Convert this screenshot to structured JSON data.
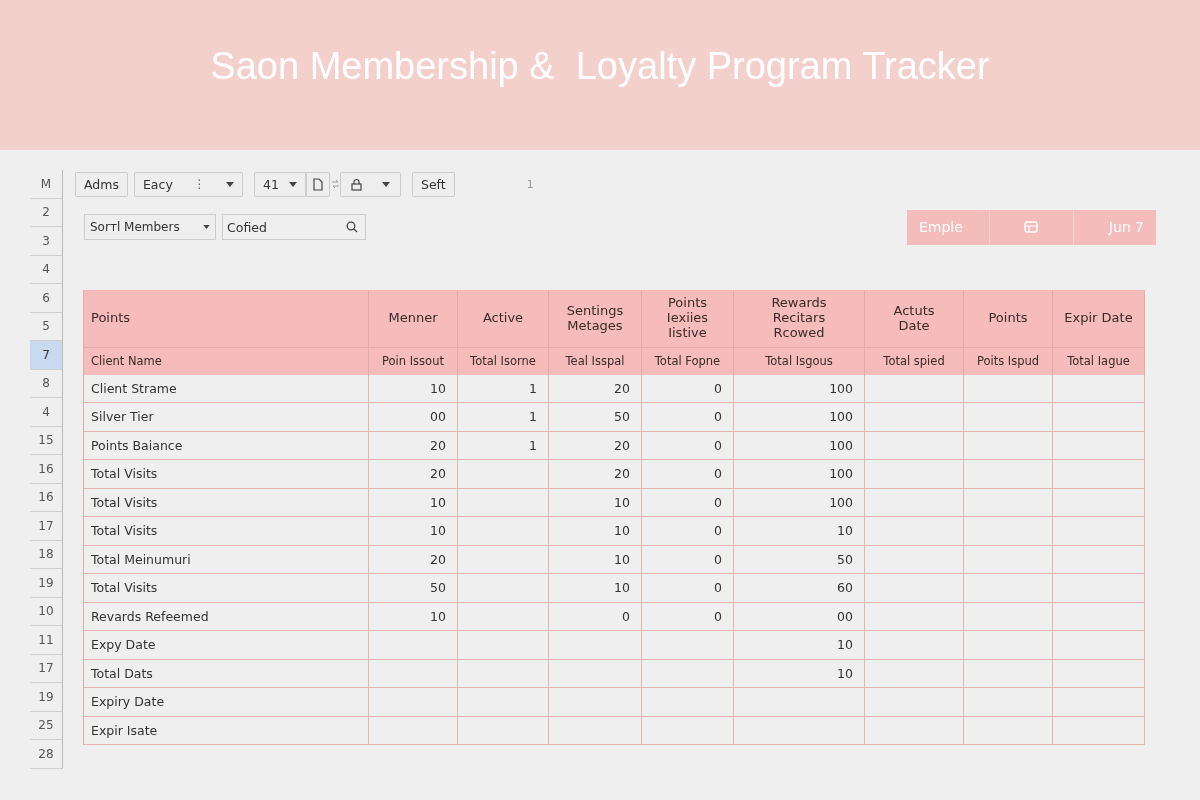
{
  "title": "Saon Membership &  Loyalty Program Tracker",
  "row_headers": [
    {
      "label": "M",
      "selected": false
    },
    {
      "label": "2",
      "selected": false
    },
    {
      "label": "3",
      "selected": false
    },
    {
      "label": "4",
      "selected": false
    },
    {
      "label": "6",
      "selected": false
    },
    {
      "label": "5",
      "selected": false
    },
    {
      "label": "7",
      "selected": true
    },
    {
      "label": "8",
      "selected": false
    },
    {
      "label": "4",
      "selected": false
    },
    {
      "label": "15",
      "selected": false
    },
    {
      "label": "16",
      "selected": false
    },
    {
      "label": "16",
      "selected": false
    },
    {
      "label": "17",
      "selected": false
    },
    {
      "label": "18",
      "selected": false
    },
    {
      "label": "19",
      "selected": false
    },
    {
      "label": "10",
      "selected": false
    },
    {
      "label": "11",
      "selected": false
    },
    {
      "label": "17",
      "selected": false
    },
    {
      "label": "19",
      "selected": false
    },
    {
      "label": "25",
      "selected": false
    },
    {
      "label": "28",
      "selected": false
    }
  ],
  "toolbar": [
    {
      "kind": "button",
      "label": "Adms"
    },
    {
      "kind": "dropdown",
      "label": "Eacy",
      "glyph": "⋮"
    },
    {
      "kind": "dropdown",
      "label": "41"
    },
    {
      "kind": "doc-button"
    },
    {
      "kind": "lock-dropdown"
    },
    {
      "kind": "button",
      "label": "Seft"
    }
  ],
  "page_indicator": "1",
  "filter": {
    "label": "Sorтl Members"
  },
  "search": {
    "value": "Cofied"
  },
  "date_bar": {
    "label": "Emple",
    "date": "Jun 7"
  },
  "table": {
    "columns": [
      "Points",
      "Menner",
      "Active",
      "Sentings\nMetages",
      "Points\nIexiies\nIistive",
      "Rewards\nRecitars\nRcowed",
      "Actuts\nDate",
      "Points",
      "Expir Date"
    ],
    "subheaders": [
      "Client Name",
      "Poin Issout",
      "Total Isorne",
      "Teal Isspal",
      "Total Fopne",
      "Total Isgous",
      "Total spied",
      "Poits Ispud",
      "Total Iague"
    ],
    "rows": [
      {
        "label": "Client Strame",
        "cells": {
          "column_2": "10",
          "column_3": "1",
          "column_4": "20",
          "column_5": "0",
          "column_6": "100"
        }
      },
      {
        "label": "Silver Tier",
        "cells": {
          "column_2": "00",
          "column_3": "1",
          "column_4": "50",
          "column_5": "0",
          "column_6": "100"
        }
      },
      {
        "label": "Points Baiance",
        "cells": {
          "column_2": "20",
          "column_3": "1",
          "column_4": "20",
          "column_5": "0",
          "column_6": "100"
        }
      },
      {
        "label": "Total Visits",
        "cells": {
          "column_2": "20",
          "column_4": "20",
          "column_5": "0",
          "column_6": "100"
        }
      },
      {
        "label": "Total Visits",
        "cells": {
          "column_2": "10",
          "column_4": "10",
          "column_5": "0",
          "column_6": "100"
        }
      },
      {
        "label": "Total Visits",
        "cells": {
          "column_2": "10",
          "column_4": "10",
          "column_5": "0",
          "column_6": "10"
        }
      },
      {
        "label": "Total Meinumuri",
        "cells": {
          "column_2": "20",
          "column_4": "10",
          "column_5": "0",
          "column_6": "50"
        }
      },
      {
        "label": "Total Visits",
        "cells": {
          "column_2": "50",
          "column_4": "10",
          "column_5": "0",
          "column_6": "60"
        }
      },
      {
        "label": "Revards Refeemed",
        "cells": {
          "column_2": "10",
          "column_4": "0",
          "column_5": "0",
          "column_6": "00"
        }
      },
      {
        "label": "Expy Date",
        "cells": {
          "column_6": "10"
        }
      },
      {
        "label": "Total Dats",
        "cells": {
          "column_6": "10"
        }
      },
      {
        "label": "Expiry Date"
      },
      {
        "label": "Expir Isate"
      }
    ]
  }
}
